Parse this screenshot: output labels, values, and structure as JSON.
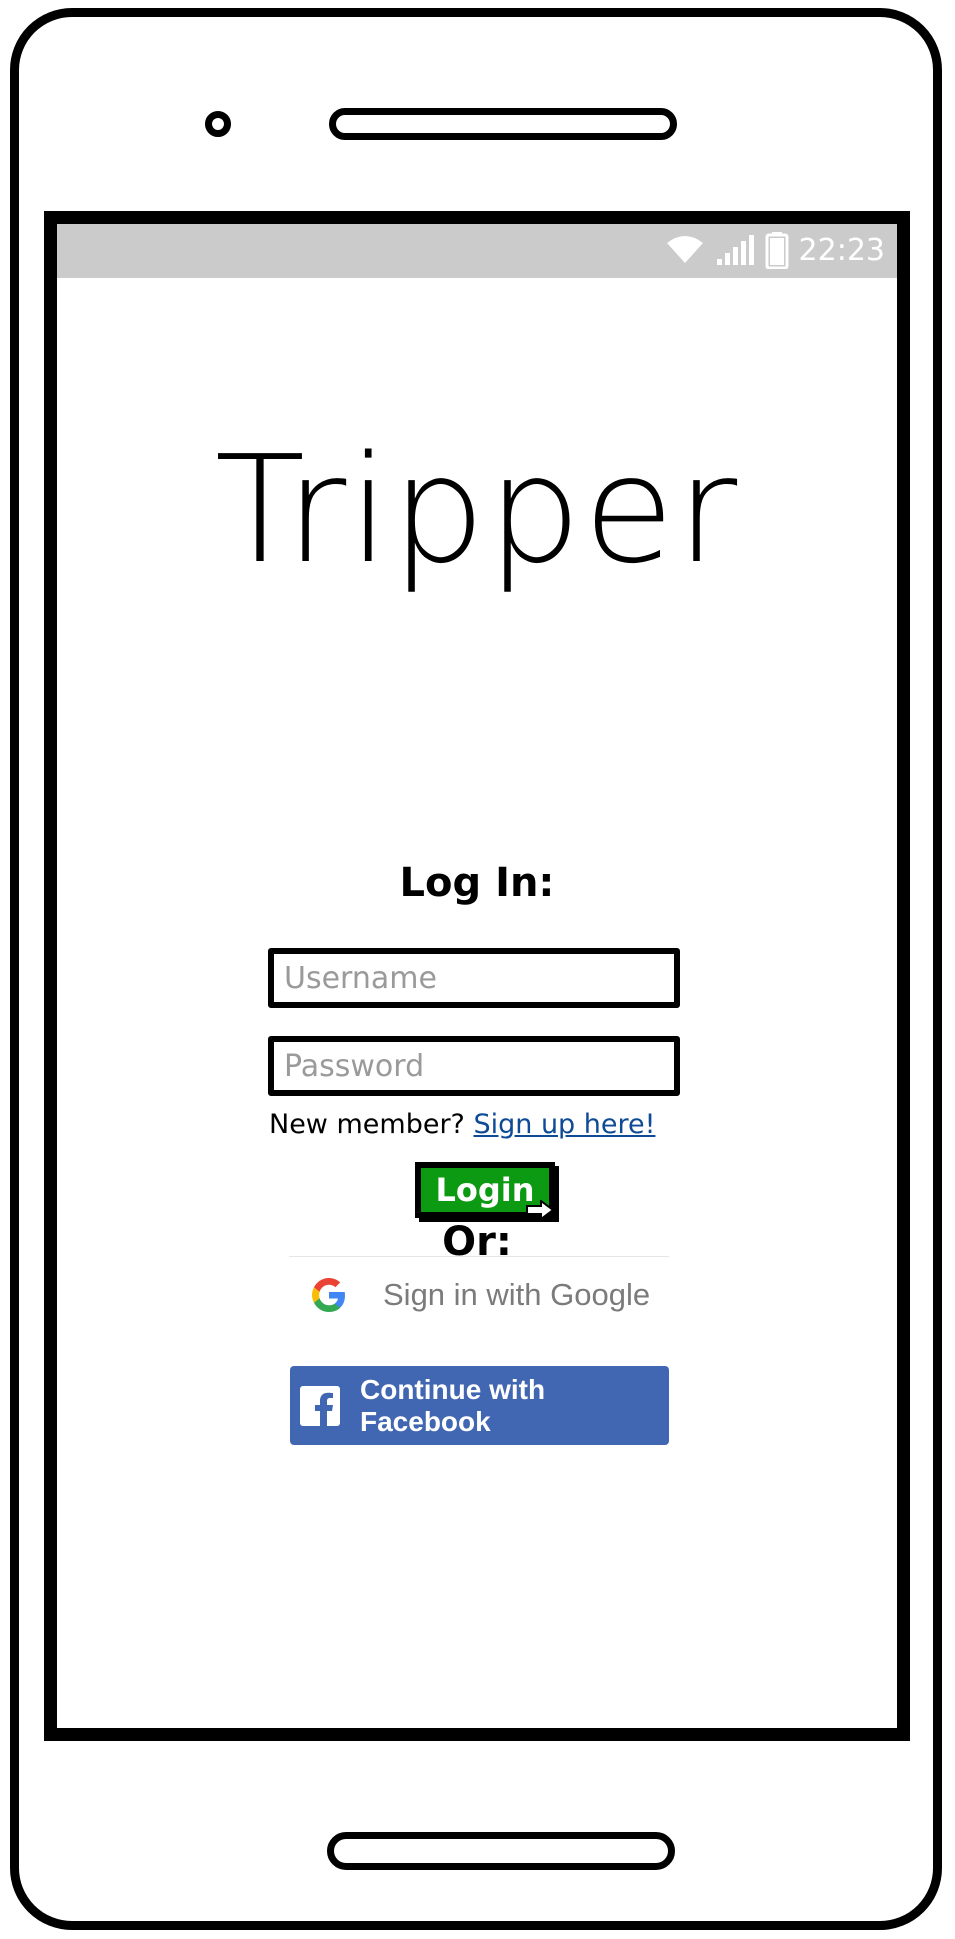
{
  "status_bar": {
    "time": "22:23",
    "icons": [
      "wifi-icon",
      "signal-icon",
      "battery-icon"
    ]
  },
  "app": {
    "logo_text": "Tripper"
  },
  "login": {
    "title": "Log In:",
    "username_placeholder": "Username",
    "password_placeholder": "Password",
    "new_member_text": "New member?",
    "signup_link": "Sign up here!",
    "login_button": "Login",
    "or_label": "Or:"
  },
  "social": {
    "google_label": "Sign in with Google",
    "facebook_label": "Continue with Facebook"
  },
  "colors": {
    "status_bar": "#cbcbcb",
    "login_button": "#0c9a12",
    "facebook": "#4267b2",
    "link": "#0e4a96"
  }
}
